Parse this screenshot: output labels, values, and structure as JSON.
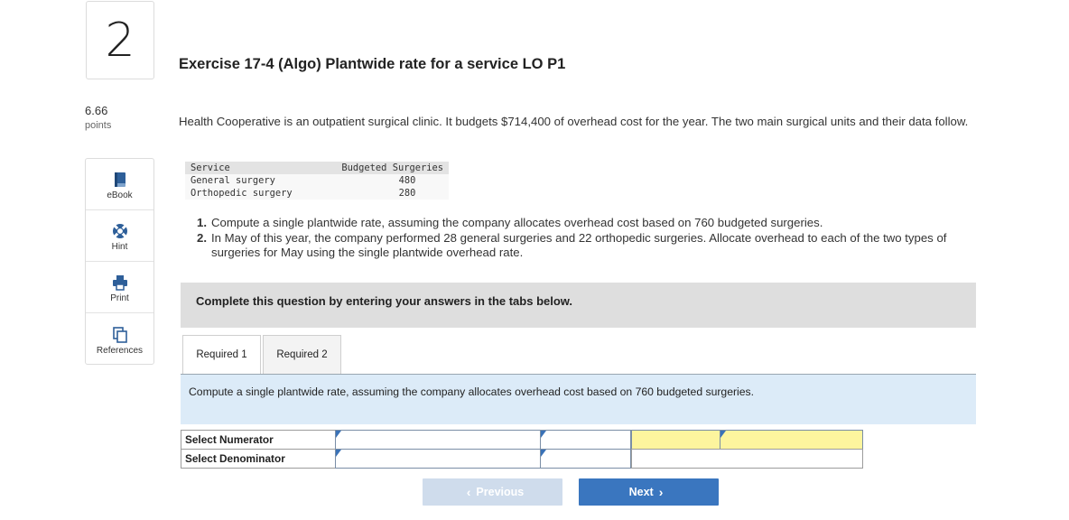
{
  "question": {
    "number": "2",
    "points_value": "6.66",
    "points_label": "points"
  },
  "tools": [
    {
      "label": "eBook",
      "icon": "book-icon"
    },
    {
      "label": "Hint",
      "icon": "lifebuoy-icon"
    },
    {
      "label": "Print",
      "icon": "printer-icon"
    },
    {
      "label": "References",
      "icon": "references-icon"
    }
  ],
  "exercise": {
    "title": "Exercise 17-4 (Algo) Plantwide rate for a service LO P1",
    "intro": "Health Cooperative is an outpatient surgical clinic. It budgets $714,400 of overhead cost for the year. The two main surgical units and their data follow."
  },
  "table": {
    "headers": [
      "Service",
      "Budgeted Surgeries"
    ],
    "rows": [
      [
        "General surgery",
        "480"
      ],
      [
        "Orthopedic surgery",
        "280"
      ]
    ]
  },
  "requirements": [
    {
      "num": "1.",
      "text": "Compute a single plantwide rate, assuming the company allocates overhead cost based on 760 budgeted surgeries."
    },
    {
      "num": "2.",
      "text": "In May of this year, the company performed 28 general surgeries and 22 orthopedic surgeries. Allocate overhead to each of the two types of surgeries for May using the single plantwide overhead rate."
    }
  ],
  "banner": "Complete this question by entering your answers in the tabs below.",
  "tabs": [
    "Required 1",
    "Required 2"
  ],
  "instruction": "Compute a single plantwide rate, assuming the company allocates overhead cost based on 760 budgeted surgeries.",
  "answer_grid": {
    "numerator_label": "Select Numerator",
    "denominator_label": "Select Denominator"
  },
  "nav": {
    "previous_label": "Previous",
    "next_label": "Next"
  },
  "colors": {
    "accent": "#3a76bf",
    "instruction_bg": "#dcebf8",
    "highlight": "#fdf59e"
  }
}
